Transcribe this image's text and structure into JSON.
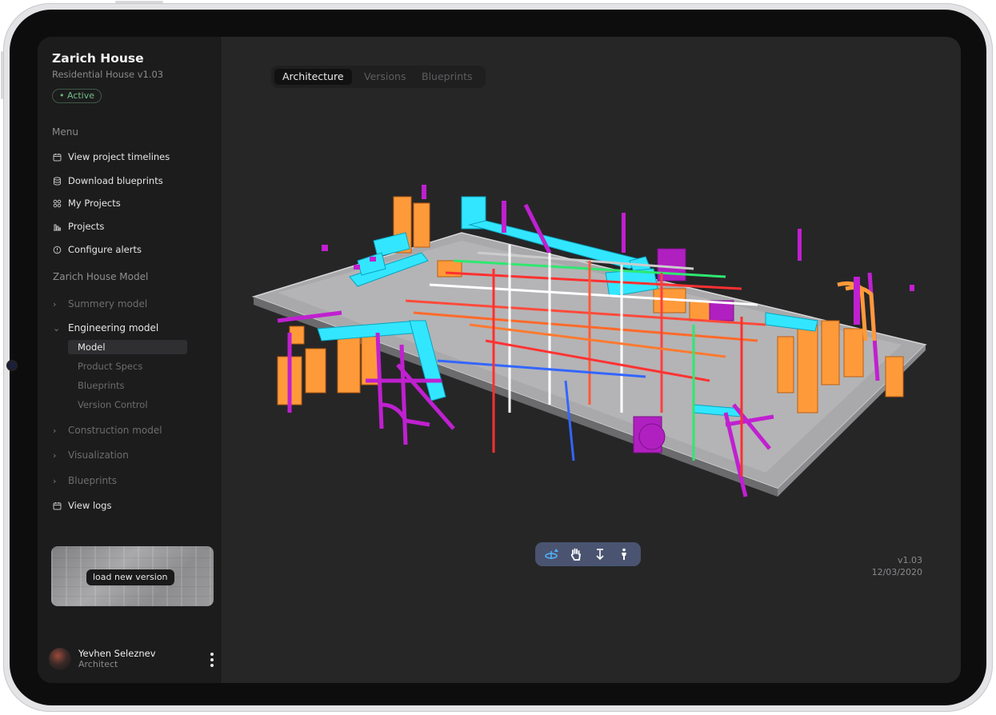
{
  "project": {
    "title": "Zarich House",
    "subtitle": "Residential House v1.03",
    "status": "• Active"
  },
  "menu": {
    "heading": "Menu",
    "items": [
      {
        "label": "View project timelines",
        "icon": "calendar-icon"
      },
      {
        "label": "Download blueprints",
        "icon": "database-icon"
      },
      {
        "label": "My Projects",
        "icon": "grid-icon"
      },
      {
        "label": "Projects",
        "icon": "chart-icon"
      },
      {
        "label": "Configure alerts",
        "icon": "info-icon"
      }
    ]
  },
  "model_section": {
    "heading": "Zarich House Model",
    "tree": [
      {
        "label": "Summery model",
        "expanded": false
      },
      {
        "label": "Engineering model",
        "expanded": true
      },
      {
        "label": "Construction model",
        "expanded": false
      },
      {
        "label": "Visualization",
        "expanded": false
      },
      {
        "label": "Blueprints",
        "expanded": false
      }
    ],
    "engineering_children": [
      "Model",
      "Product Specs",
      "Blueprints",
      "Version Control"
    ],
    "selected_child": "Model",
    "view_logs": "View logs"
  },
  "load_card": {
    "button_label": "load new version"
  },
  "user": {
    "name": "Yevhen Seleznev",
    "role": "Architect"
  },
  "tabs": [
    {
      "label": "Architecture",
      "active": true
    },
    {
      "label": "Versions",
      "active": false
    },
    {
      "label": "Blueprints",
      "active": false
    }
  ],
  "viewer_tools": [
    {
      "name": "orbit-icon",
      "active": true
    },
    {
      "name": "pan-hand-icon",
      "active": false
    },
    {
      "name": "vertical-move-icon",
      "active": false
    },
    {
      "name": "walk-person-icon",
      "active": false
    }
  ],
  "version_info": {
    "version": "v1.03",
    "date": "12/03/2020"
  },
  "colors": {
    "accent_active": "#6fbf84",
    "toolbar_bg": "#4a5470",
    "tool_active": "#4fb3ff",
    "duct_cyan": "#33e6ff",
    "equipment_orange": "#ff9a3a",
    "pipe_magenta": "#c020d0"
  }
}
